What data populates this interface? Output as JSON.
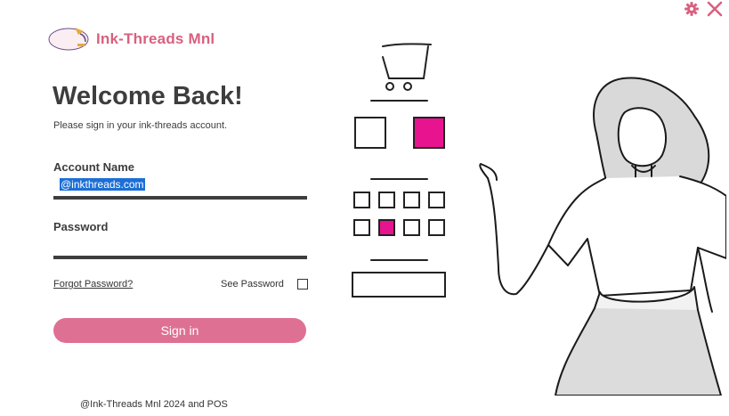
{
  "brand": {
    "name": "Ink-Threads Mnl",
    "logo_text": "Ink Threads"
  },
  "login": {
    "title": "Welcome Back!",
    "subtitle": "Please sign in your ink-threads account.",
    "account_label": "Account Name",
    "account_value": "@inkthreads.com",
    "password_label": "Password",
    "password_value": "",
    "forgot_label": "Forgot Password?",
    "see_password_label": "See Password",
    "see_password_checked": false,
    "signin_label": "Sign in"
  },
  "footer": {
    "text": "@Ink-Threads Mnl 2024 and POS"
  },
  "window": {
    "icons": [
      "gear-icon",
      "close-icon"
    ]
  },
  "colors": {
    "accent": "#de7193",
    "brand": "#d9607f",
    "magenta": "#e8138f",
    "text": "#3d3d3d"
  }
}
